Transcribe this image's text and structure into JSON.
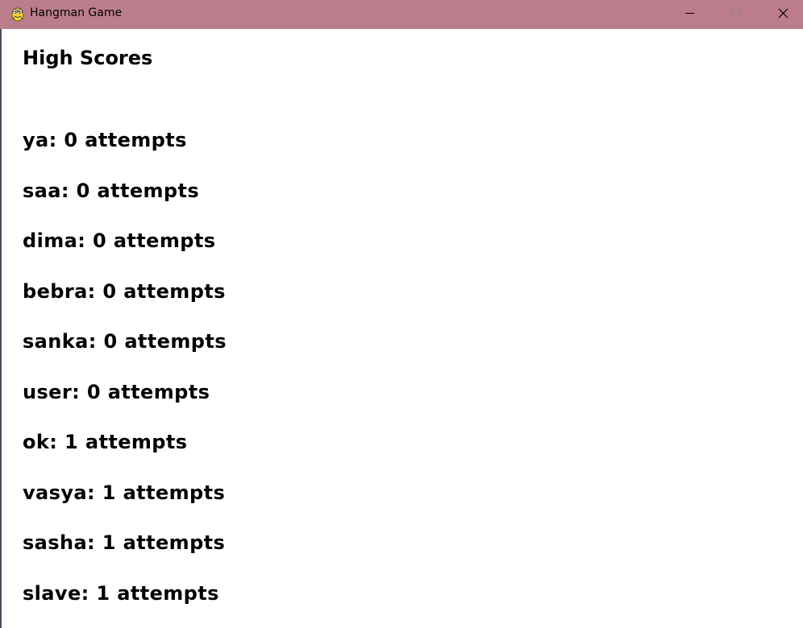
{
  "window": {
    "title": "Hangman Game",
    "titlebar_color": "#bb7d8c",
    "app_icon": "pygame-snake-icon",
    "controls": {
      "minimize_icon": "minimize-icon",
      "maximize_icon": "maximize-icon",
      "close_icon": "close-icon"
    }
  },
  "main": {
    "heading": "High Scores",
    "scores": [
      {
        "text": "ya: 0 attempts"
      },
      {
        "text": "saa: 0 attempts"
      },
      {
        "text": "dima: 0 attempts"
      },
      {
        "text": "bebra: 0 attempts"
      },
      {
        "text": "sanka: 0 attempts"
      },
      {
        "text": "user: 0 attempts"
      },
      {
        "text": "ok: 1 attempts"
      },
      {
        "text": "vasya: 1 attempts"
      },
      {
        "text": "sasha: 1 attempts"
      },
      {
        "text": "slave: 1 attempts"
      }
    ]
  }
}
